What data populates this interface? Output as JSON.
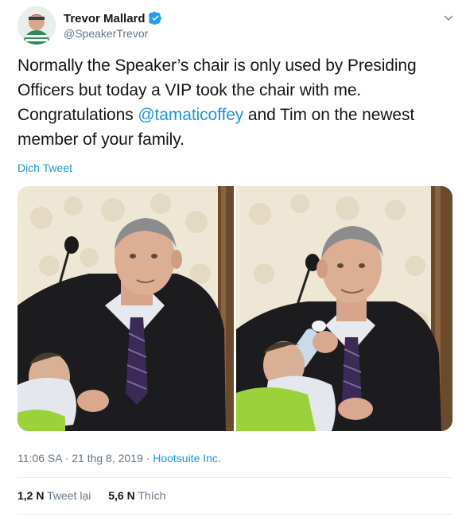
{
  "author": {
    "display_name": "Trevor Mallard",
    "handle": "@SpeakerTrevor"
  },
  "tweet": {
    "text_before": "Normally the Speaker’s chair is only used by Presiding Officers but today a VIP took the chair with me. Congratulations ",
    "mention": "@tamaticoffey",
    "text_after": " and Tim on the newest member of your family."
  },
  "translate_label": "Dịch Tweet",
  "meta": {
    "timestamp": "11:06 SA · 21 thg 8, 2019",
    "separator": " · ",
    "source": "Hootsuite Inc."
  },
  "stats": {
    "retweets_count": "1,2 N",
    "retweets_label": "Tweet lại",
    "likes_count": "5,6 N",
    "likes_label": "Thích"
  },
  "colors": {
    "link": "#1b95e0",
    "verified": "#1da1f2",
    "muted": "#657786"
  },
  "icons": [
    "verified-badge-icon",
    "chevron-down-icon"
  ]
}
